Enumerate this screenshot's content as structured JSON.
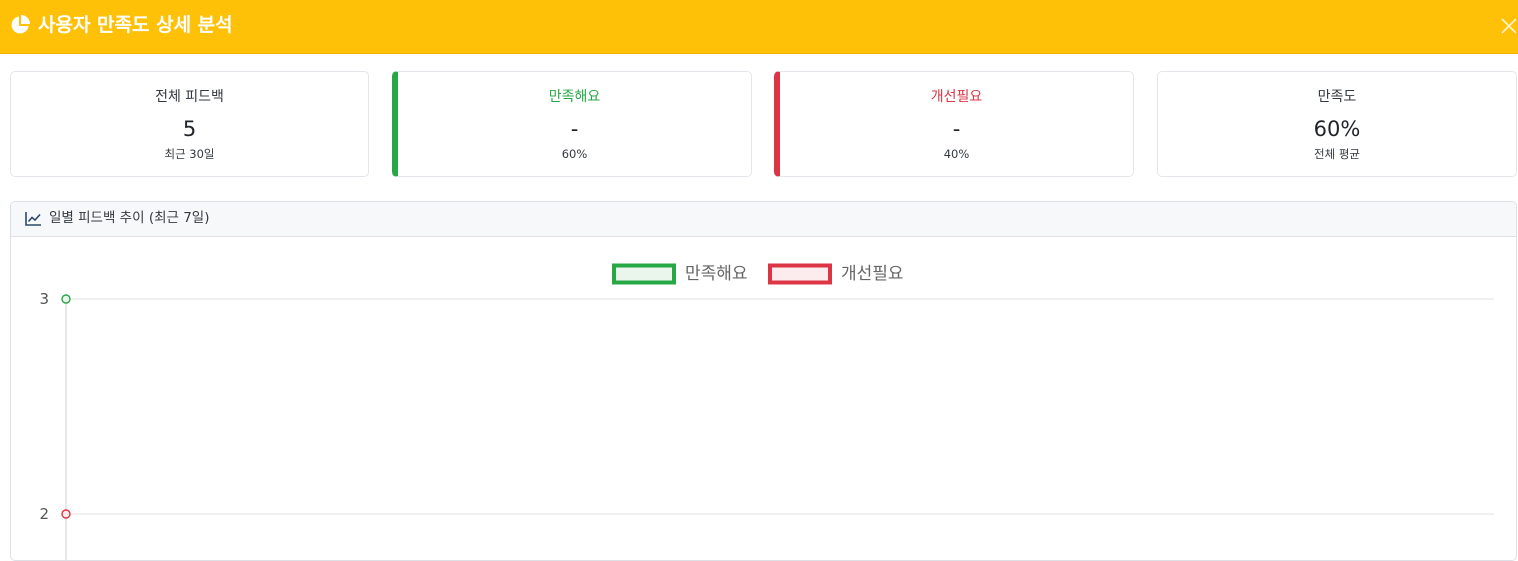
{
  "header": {
    "title": "사용자 만족도 상세 분석",
    "icon": "pie-chart-icon",
    "close_icon": "close-icon",
    "background": "#ffc107"
  },
  "stats": [
    {
      "title": "전체 피드백",
      "value": "5",
      "sub": "최근 30일"
    },
    {
      "title": "만족해요",
      "value": "-",
      "sub": "60%",
      "accent": "#28a745"
    },
    {
      "title": "개선필요",
      "value": "-",
      "sub": "40%",
      "accent": "#dc3545"
    },
    {
      "title": "만족도",
      "value": "60%",
      "sub": "전체 평균"
    }
  ],
  "panel": {
    "title": "일별 피드백 추이 (최근 7일)",
    "icon": "line-chart-icon"
  },
  "chart_data": {
    "type": "line",
    "title": "",
    "xlabel": "",
    "ylabel": "",
    "legend_position": "top-center",
    "grid": true,
    "y_ticks": [
      "3",
      "2"
    ],
    "ylim": [
      2,
      3
    ],
    "series": [
      {
        "name": "만족해요",
        "color": "#28a745",
        "fill": "#eaf6ec",
        "values": [
          3
        ]
      },
      {
        "name": "개선필요",
        "color": "#dc3545",
        "fill": "#fdecee",
        "values": [
          2
        ]
      }
    ]
  }
}
